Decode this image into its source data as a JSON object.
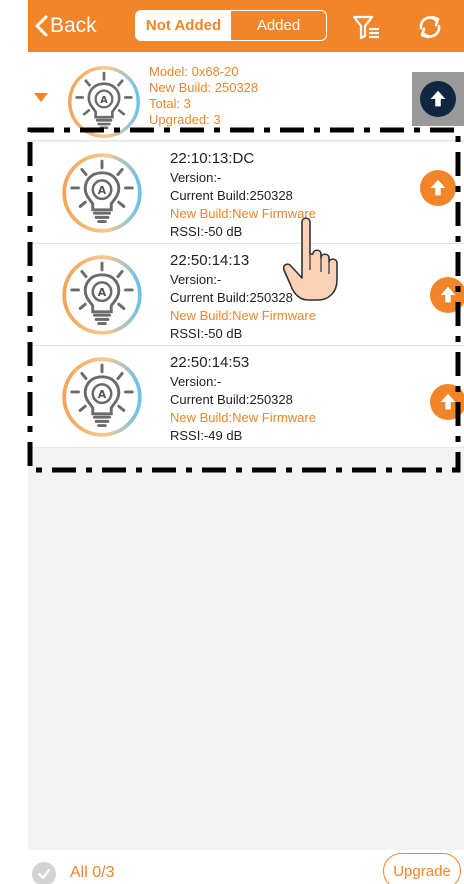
{
  "header": {
    "back_label": "Back",
    "tabs": [
      {
        "label": "Not Added",
        "active": true
      },
      {
        "label": "Added",
        "active": false
      }
    ],
    "filter_icon": "filter-list-icon",
    "refresh_icon": "refresh-icon"
  },
  "group": {
    "model": "Model: 0x68-20",
    "new_build": "New Build: 250328",
    "total": "Total: 3",
    "upgraded": "Upgraded: 3"
  },
  "devices": [
    {
      "mac": "22:10:13:DC",
      "version": "Version:-",
      "current_build": "Current Build:250328",
      "new_build": "New Build:New Firmware",
      "rssi": "RSSI:-50 dB"
    },
    {
      "mac": "22:50:14:13",
      "version": "Version:-",
      "current_build": "Current Build:250328",
      "new_build": "New Build:New Firmware",
      "rssi": "RSSI:-50 dB"
    },
    {
      "mac": "22:50:14:53",
      "version": "Version:-",
      "current_build": "Current Build:250328",
      "new_build": "New Build:New Firmware",
      "rssi": "RSSI:-49 dB"
    }
  ],
  "footer": {
    "all_label": "All 0/3",
    "upgrade_label": "Upgrade"
  },
  "colors": {
    "accent": "#f2842a",
    "group_upgrade": "#0f2740",
    "background": "#f3f3f3"
  }
}
